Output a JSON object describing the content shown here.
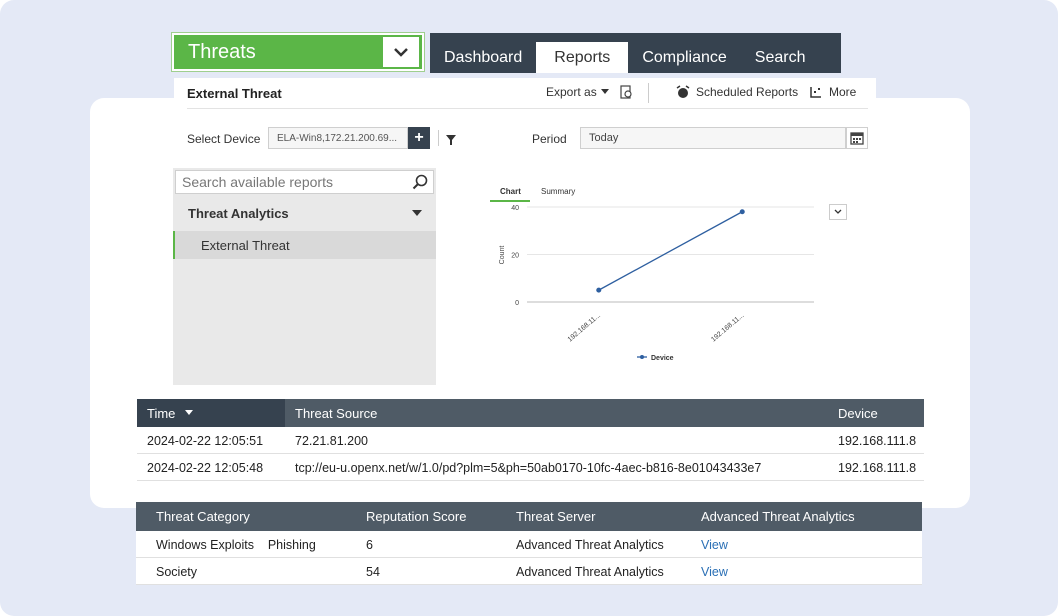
{
  "module_select": {
    "label": "Threats"
  },
  "nav": {
    "tabs": [
      "Dashboard",
      "Reports",
      "Compliance",
      "Search"
    ],
    "active": "Reports"
  },
  "report_header": {
    "title": "External Threat",
    "export_label": "Export as",
    "scheduled_label": "Scheduled Reports",
    "more_label": "More",
    "select_device_label": "Select Device",
    "device_value": "ELA-Win8,172.21.200.69...",
    "period_label": "Period",
    "period_value": "Today"
  },
  "sidebar": {
    "search_placeholder": "Search available reports",
    "group": "Threat Analytics",
    "items": [
      "External Threat"
    ]
  },
  "chart_tabs": [
    "Chart",
    "Summary"
  ],
  "chart_data": {
    "type": "line",
    "categories": [
      "192.168.11...",
      "192.168.11..."
    ],
    "series": [
      {
        "name": "Device",
        "values": [
          5,
          38
        ]
      }
    ],
    "ylabel": "Count",
    "ylim": [
      0,
      40
    ],
    "yticks": [
      "0",
      "20",
      "40"
    ],
    "color": "#2e5fa0",
    "legend": "bottom"
  },
  "threats_table": {
    "columns": [
      "Time",
      "Threat Source",
      "Device"
    ],
    "rows": [
      [
        "2024-02-22 12:05:51",
        "72.21.81.200",
        "192.168.111.8"
      ],
      [
        "2024-02-22 12:05:48",
        "tcp://eu-u.openx.net/w/1.0/pd?plm=5&ph=50ab0170-10fc-4aec-b816-8e01043433e7",
        "192.168.111.8"
      ]
    ]
  },
  "detail_table": {
    "columns": [
      "Threat Category",
      "Reputation Score",
      "Threat Server",
      "Advanced Threat Analytics"
    ],
    "rows": [
      [
        "Windows Exploits    Phishing",
        "6",
        "Advanced Threat Analytics",
        "View"
      ],
      [
        "Society",
        "54",
        "Advanced Threat Analytics",
        "View"
      ]
    ]
  },
  "colors": {
    "accent": "#5bb647",
    "nav": "#36424f",
    "table_header": "#4f5b66",
    "link": "#2a6fb5"
  }
}
